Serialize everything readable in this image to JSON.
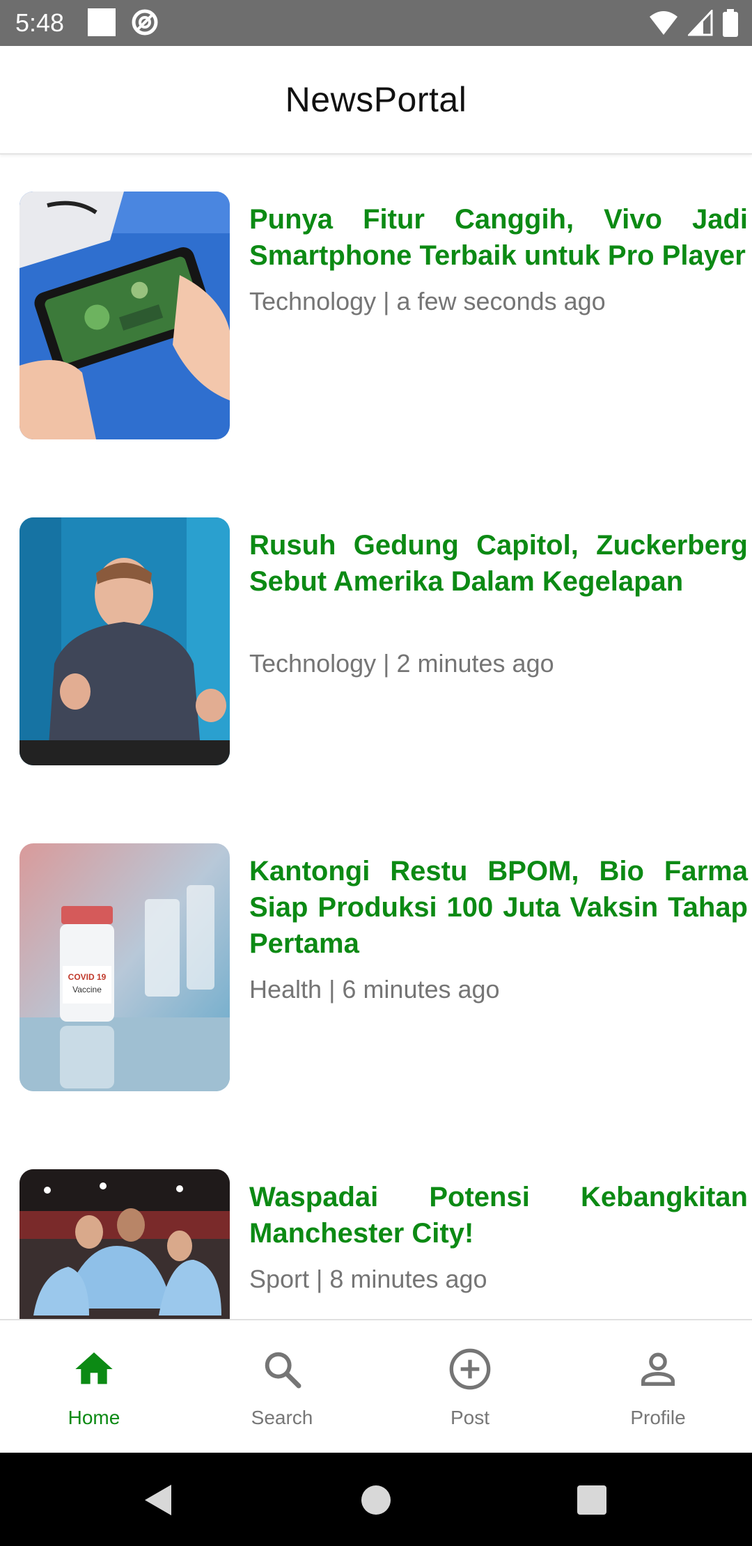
{
  "status_bar": {
    "time": "5:48"
  },
  "app_bar": {
    "title": "NewsPortal"
  },
  "news": [
    {
      "title": "Punya Fitur Canggih, Vivo Jadi Smartphone Terbaik untuk Pro Player",
      "meta": "Technology | a few seconds ago",
      "image": "phone-gaming-photo"
    },
    {
      "title": "Rusuh Gedung Capitol, Zuckerberg Sebut Amerika Dalam Kegelapan",
      "meta": "Technology | 2 minutes ago",
      "image": "speaker-portrait-photo"
    },
    {
      "title": "Kantongi Restu BPOM, Bio Farma Siap Produksi 100 Juta Vaksin Tahap Pertama",
      "meta": "Health | 6 minutes ago",
      "image": "vaccine-vials-photo",
      "vial_label_1": "COVID 19",
      "vial_label_2": "Vaccine"
    },
    {
      "title": "Waspadai Potensi Kebangkitan Manchester City!",
      "meta": "Sport | 8 minutes ago",
      "image": "football-players-photo"
    }
  ],
  "bottom_nav": {
    "items": [
      {
        "label": "Home",
        "icon": "home-icon",
        "active": true
      },
      {
        "label": "Search",
        "icon": "search-icon",
        "active": false
      },
      {
        "label": "Post",
        "icon": "add-circle-icon",
        "active": false
      },
      {
        "label": "Profile",
        "icon": "person-icon",
        "active": false
      }
    ]
  },
  "colors": {
    "accent": "#0c8a14",
    "meta_text": "#757575",
    "status_bar": "#6e6e6e"
  }
}
